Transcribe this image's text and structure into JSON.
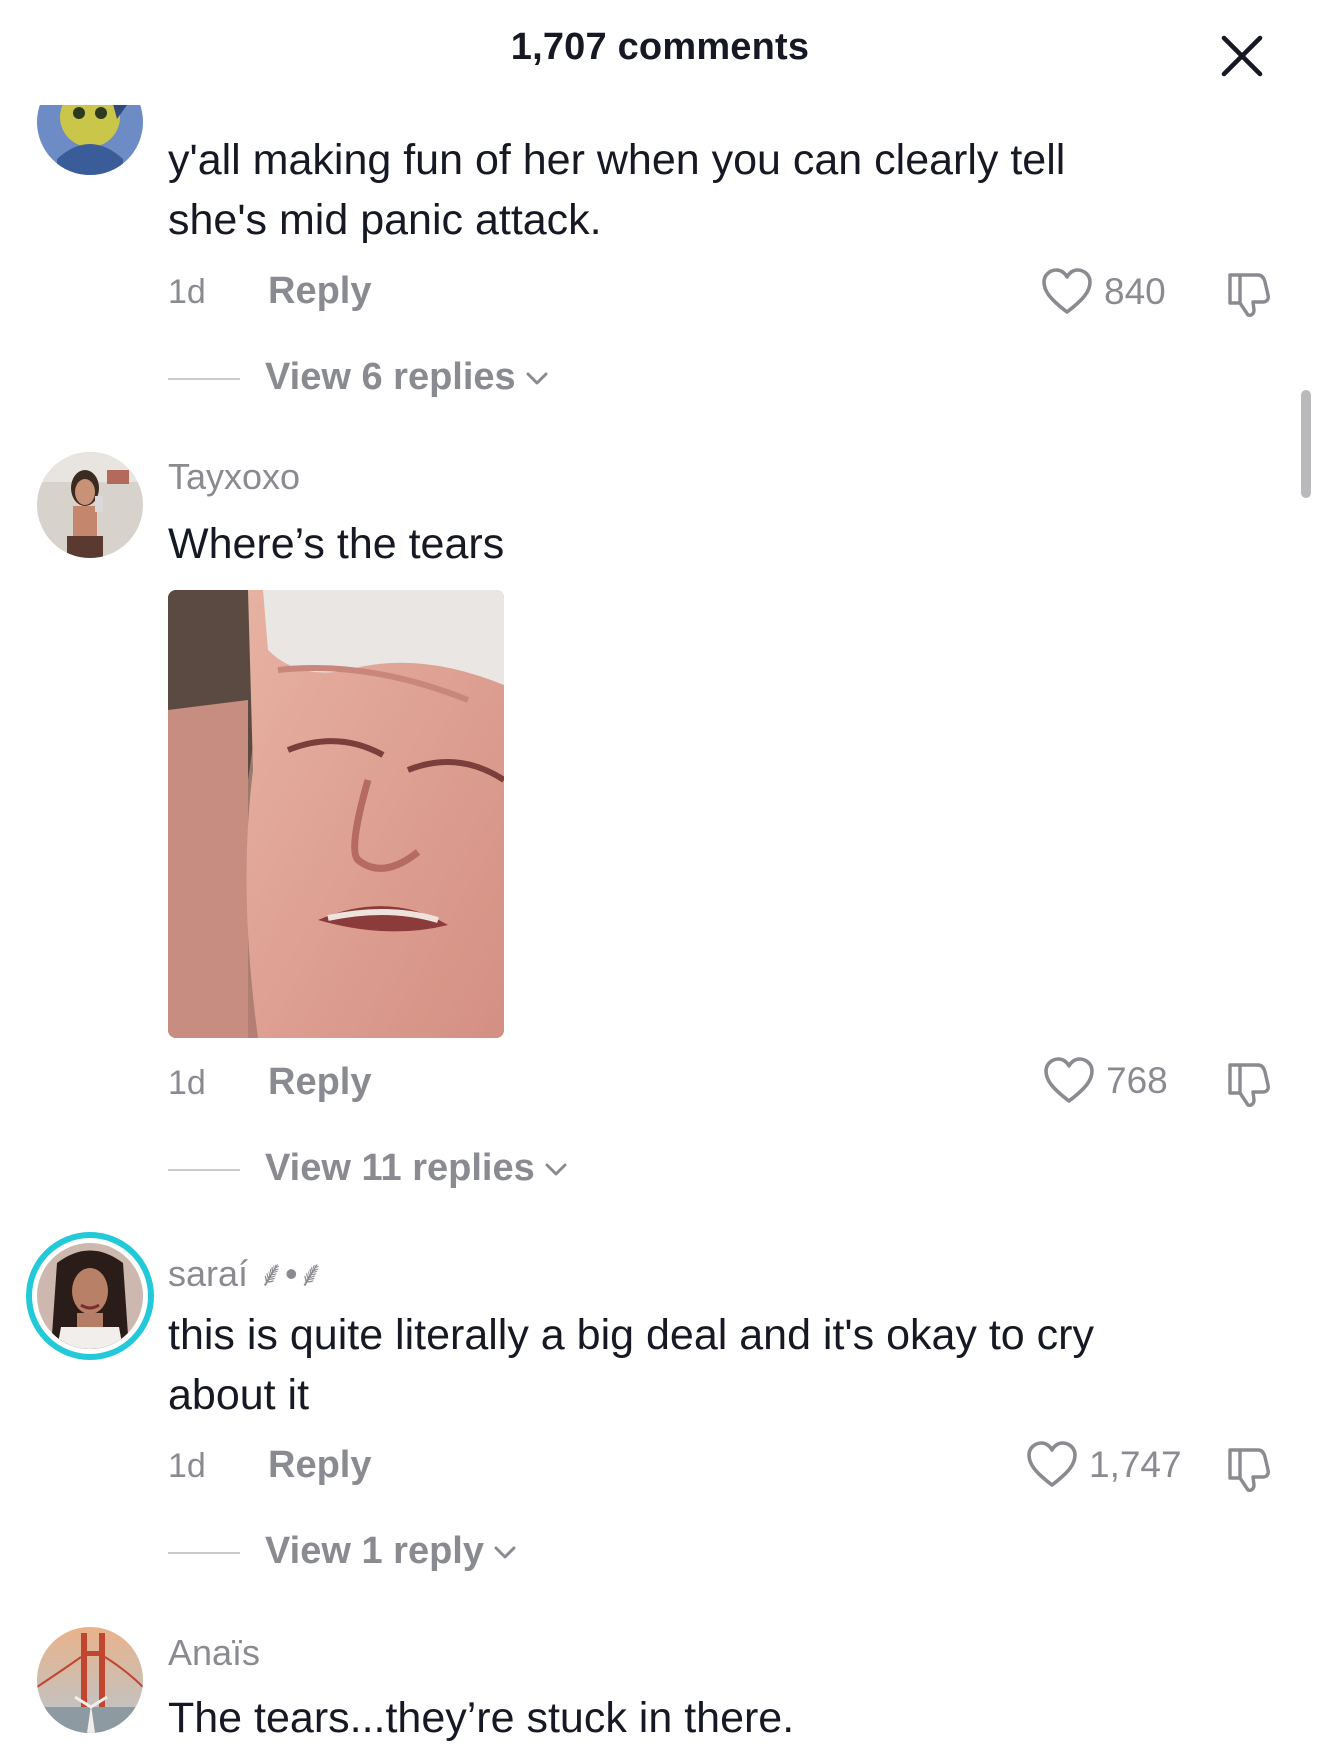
{
  "header": {
    "title": "1,707 comments"
  },
  "comments": [
    {
      "username": "",
      "text_lines": [
        "y'all making fun of her when you can clearly tell",
        "she's mid panic attack."
      ],
      "time": "1d",
      "reply_label": "Reply",
      "likes": "840",
      "view_replies": "View 6 replies"
    },
    {
      "username": "Tayxoxo",
      "text_lines": [
        "Where’s the tears"
      ],
      "time": "1d",
      "reply_label": "Reply",
      "likes": "768",
      "view_replies": "View 11 replies"
    },
    {
      "username": "saraí ⸙•⸙",
      "text_lines": [
        "this is quite literally a big deal and it's okay to cry",
        "about it"
      ],
      "time": "1d",
      "reply_label": "Reply",
      "likes": "1,747",
      "view_replies": "View 1 reply"
    },
    {
      "username": "Anaïs",
      "text_lines": [
        "The tears...they’re stuck in there."
      ]
    }
  ],
  "icons": {
    "close": "close-icon",
    "like": "heart-icon",
    "dislike": "thumbs-down-icon",
    "chevron": "chevron-down-icon"
  },
  "colors": {
    "text_primary": "#161823",
    "text_secondary": "#8a8b91",
    "story_ring": "#22c9d8"
  }
}
